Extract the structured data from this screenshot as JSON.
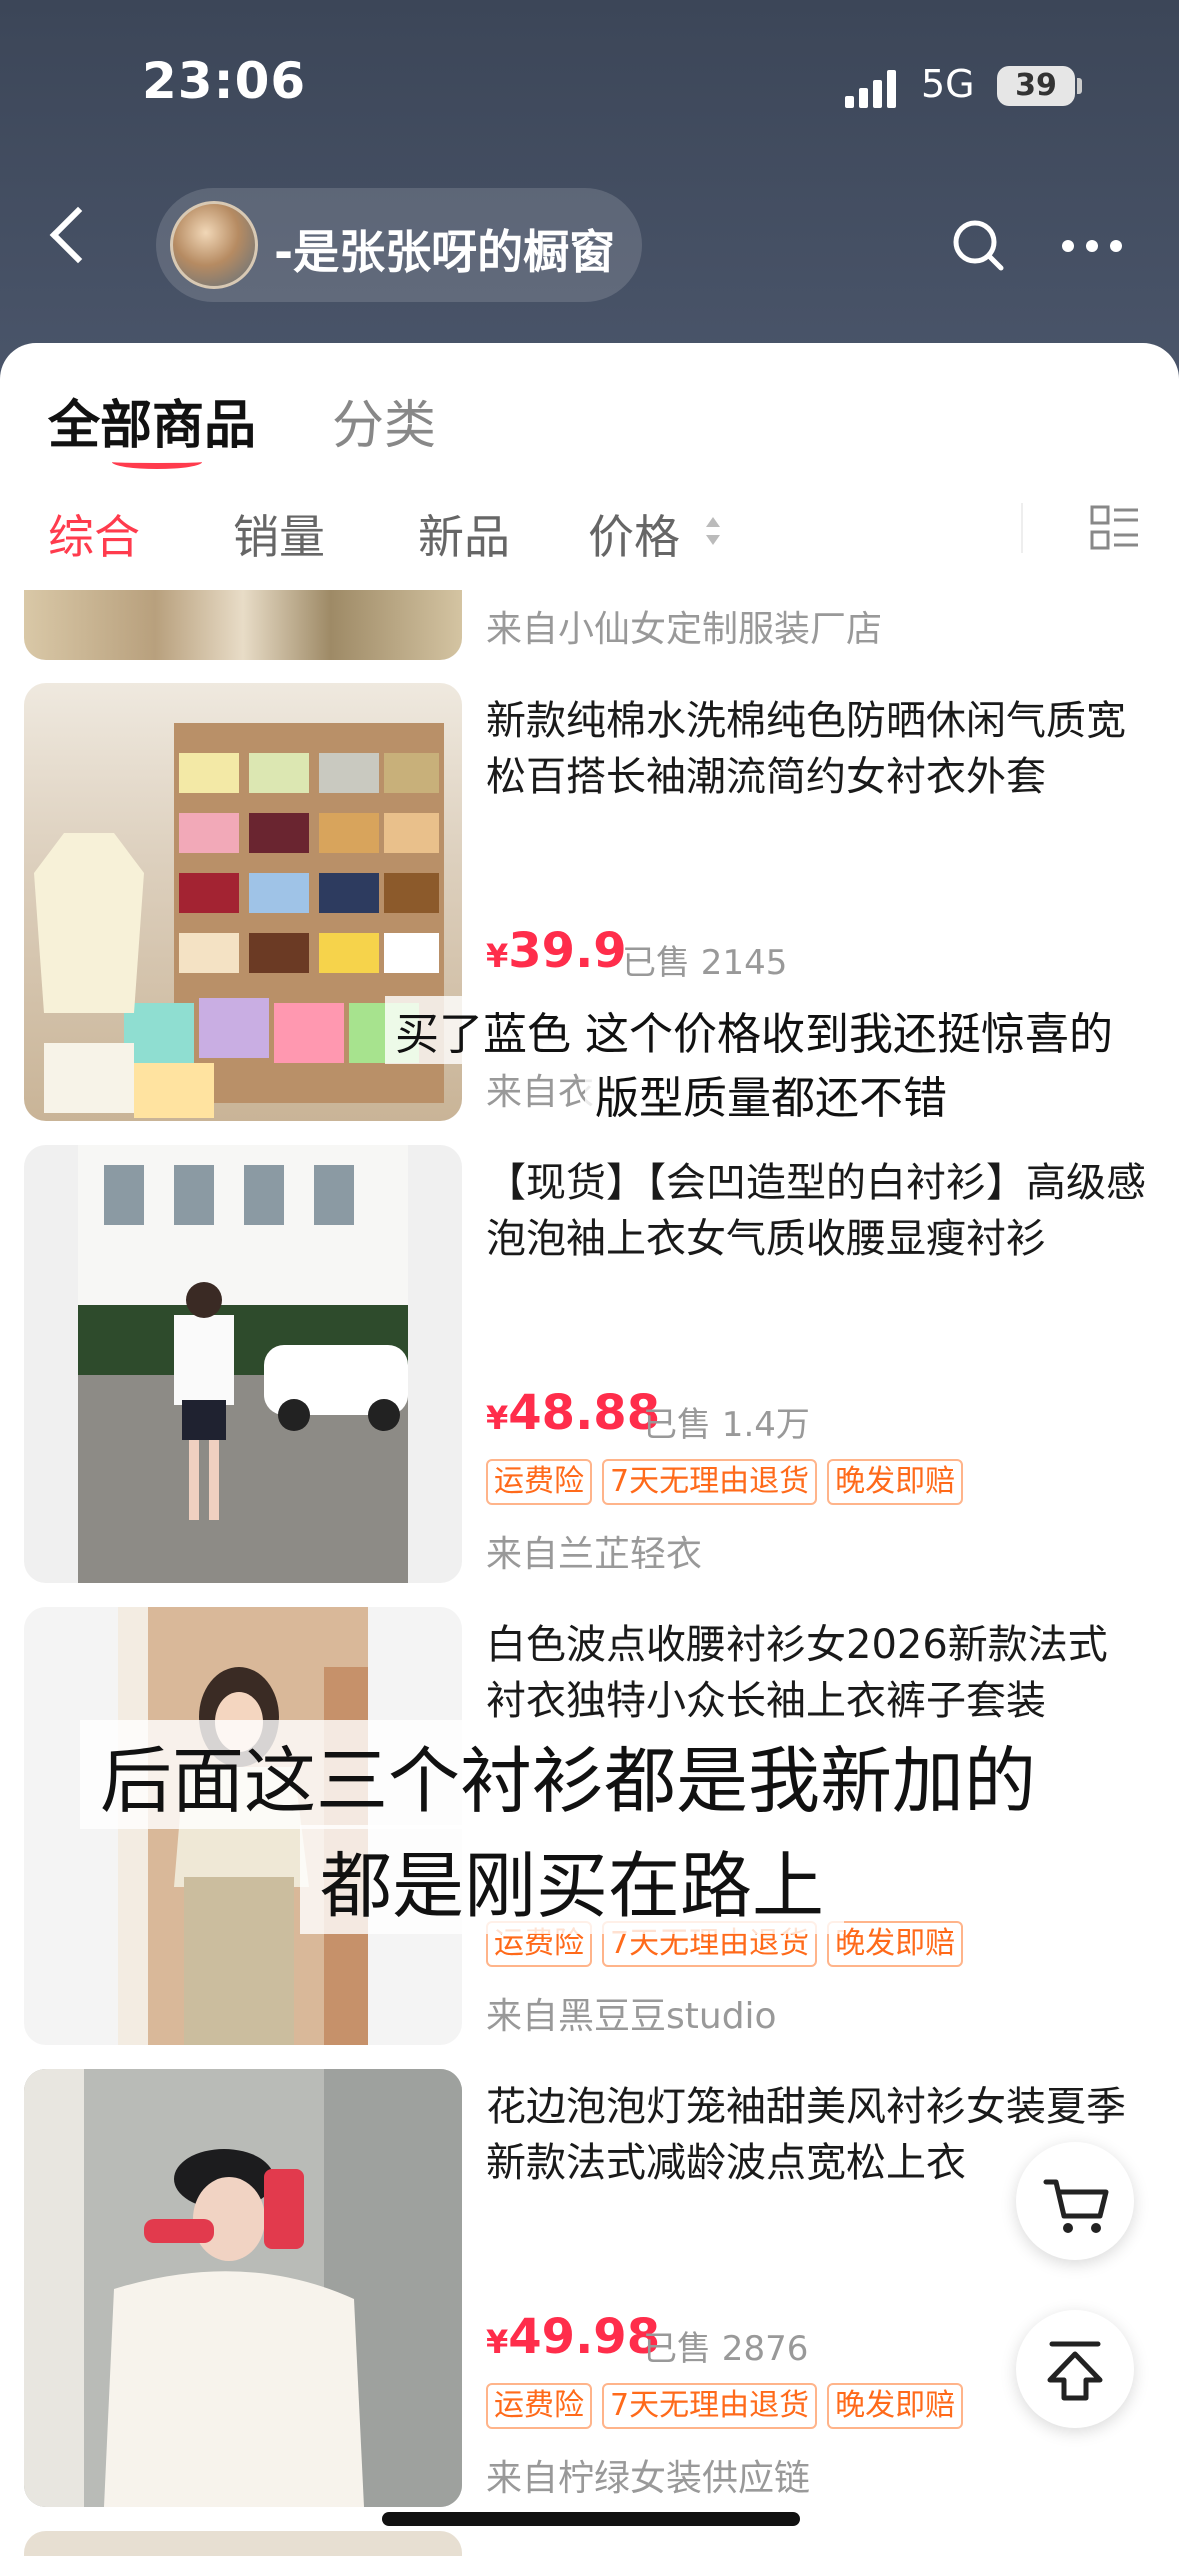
{
  "status_bar": {
    "time": "23:06",
    "network": "5G",
    "battery": "39"
  },
  "header": {
    "shop_name": "-是张张呀的橱窗"
  },
  "tabs": {
    "all": "全部商品",
    "category": "分类"
  },
  "sort": {
    "comprehensive": "综合",
    "sales": "销量",
    "new": "新品",
    "price": "价格"
  },
  "products": [
    {
      "title": "",
      "price_symbol": "",
      "price": "",
      "sold": "",
      "tags": [],
      "shop": "来自小仙女定制服装厂店"
    },
    {
      "title": "新款纯棉水洗棉纯色防晒休闲气质宽松百搭长袖潮流简约女衬衣外套",
      "price_symbol": "¥",
      "price": "39.9",
      "sold": "已售 2145",
      "tags": [],
      "shop": "来自衣"
    },
    {
      "title": "【现货】【会凹造型的白衬衫】高级感泡泡袖上衣女气质收腰显瘦衬衫",
      "price_symbol": "¥",
      "price": "48.88",
      "sold": "已售 1.4万",
      "tags": [
        "运费险",
        "7天无理由退货",
        "晚发即赔"
      ],
      "shop": "来自兰芷轻衣"
    },
    {
      "title": "白色波点收腰衬衫女2026新款法式衬衣独特小众长袖上衣裤子套装",
      "price_symbol": "",
      "price": "",
      "sold": "",
      "tags": [
        "运费险",
        "7天无理由退货",
        "晚发即赔"
      ],
      "shop": "来自黑豆豆studio"
    },
    {
      "title": "花边泡泡灯笼袖甜美风衬衫女装夏季新款法式减龄波点宽松上衣",
      "price_symbol": "¥",
      "price": "49.98",
      "sold": "已售 2876",
      "tags": [
        "运费险",
        "7天无理由退货",
        "晚发即赔"
      ],
      "shop": "来自柠绿女装供应链"
    }
  ],
  "captions": {
    "c1_line1": "买了蓝色 这个价格收到我还挺惊喜的",
    "c1_line2": "版型质量都还不错",
    "c2_line1": "后面这三个衬衫都是我新加的",
    "c2_line2": "都是刚买在路上"
  },
  "colors": {
    "accent": "#ff3b4d",
    "price": "#ff2d4b",
    "tag": "#ff6a1a"
  }
}
